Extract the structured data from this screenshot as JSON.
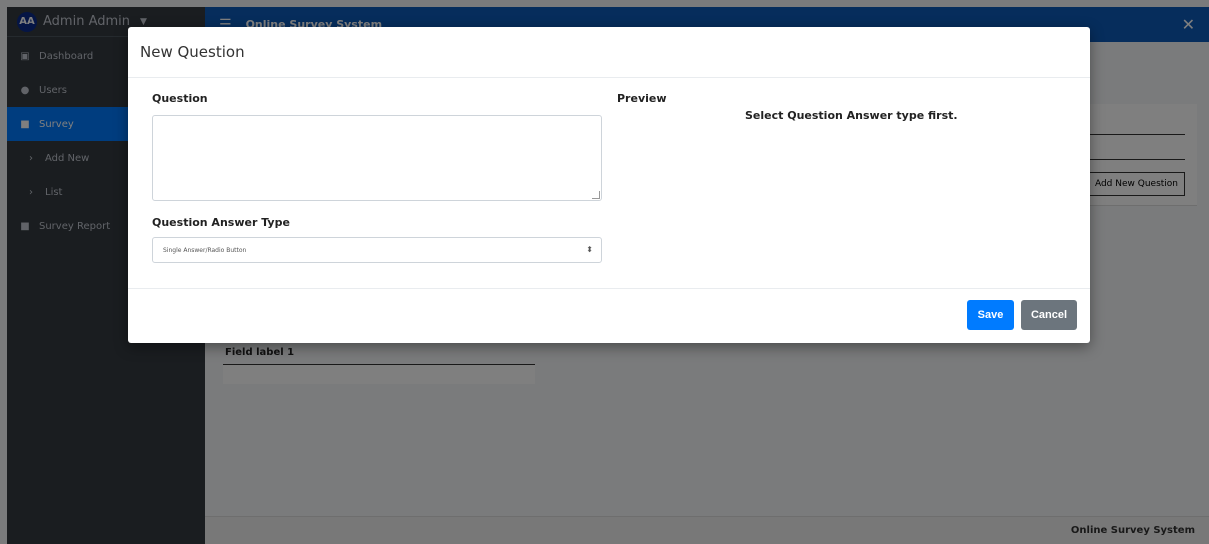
{
  "sidebar": {
    "avatar_initials": "AA",
    "user_name": "Admin Admin",
    "items": [
      {
        "label": "Dashboard",
        "icon": "tachometer-icon"
      },
      {
        "label": "Users",
        "icon": "users-icon"
      },
      {
        "label": "Survey",
        "icon": "poll-icon",
        "active": true
      },
      {
        "label": "Add New",
        "icon": "chevron-right-icon"
      },
      {
        "label": "List",
        "icon": "chevron-right-icon"
      },
      {
        "label": "Survey Report",
        "icon": "report-icon"
      }
    ]
  },
  "topbar": {
    "title": "Online Survey System"
  },
  "content": {
    "add_question_label": "Add New Question",
    "field_label": "Field label 1"
  },
  "footer": {
    "text": "Online Survey System"
  },
  "modal": {
    "title": "New Question",
    "question_label": "Question",
    "question_value": "",
    "answer_type_label": "Question Answer Type",
    "answer_type_selected": "Single Answer/Radio Button",
    "preview_label": "Preview",
    "preview_message": "Select Question Answer type first.",
    "save_label": "Save",
    "cancel_label": "Cancel"
  },
  "colors": {
    "sidebar_bg": "#343a40",
    "topbar_bg": "#0d5ab8",
    "primary": "#007bff",
    "secondary": "#6c757d"
  }
}
